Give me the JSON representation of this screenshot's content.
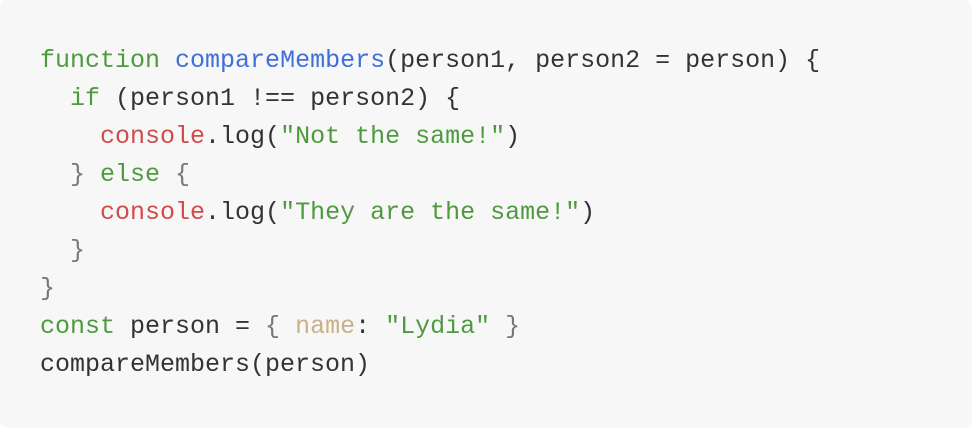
{
  "code": {
    "line1": {
      "kw": "function",
      "fn": "compareMembers",
      "rest": "(person1, person2 = person) {"
    },
    "line2": {
      "indent": "  ",
      "kw": "if",
      "rest": " (person1 !== person2) {"
    },
    "line3": {
      "indent": "    ",
      "obj": "console",
      "call": ".log(",
      "str": "\"Not the same!\"",
      "end": ")"
    },
    "line4": {
      "indent": "  ",
      "brace": "}",
      "kw": " else ",
      "brace2": "{"
    },
    "line5": {
      "indent": "    ",
      "obj": "console",
      "call": ".log(",
      "str": "\"They are the same!\"",
      "end": ")"
    },
    "line6": {
      "indent": "  ",
      "brace": "}"
    },
    "line7": {
      "brace": "}"
    },
    "line8": {
      "kw": "const",
      "mid": " person = ",
      "brace_open": "{ ",
      "prop": "name",
      "colon": ": ",
      "str": "\"Lydia\"",
      "brace_close": " }"
    },
    "line9": {
      "text": "compareMembers(person)"
    }
  }
}
